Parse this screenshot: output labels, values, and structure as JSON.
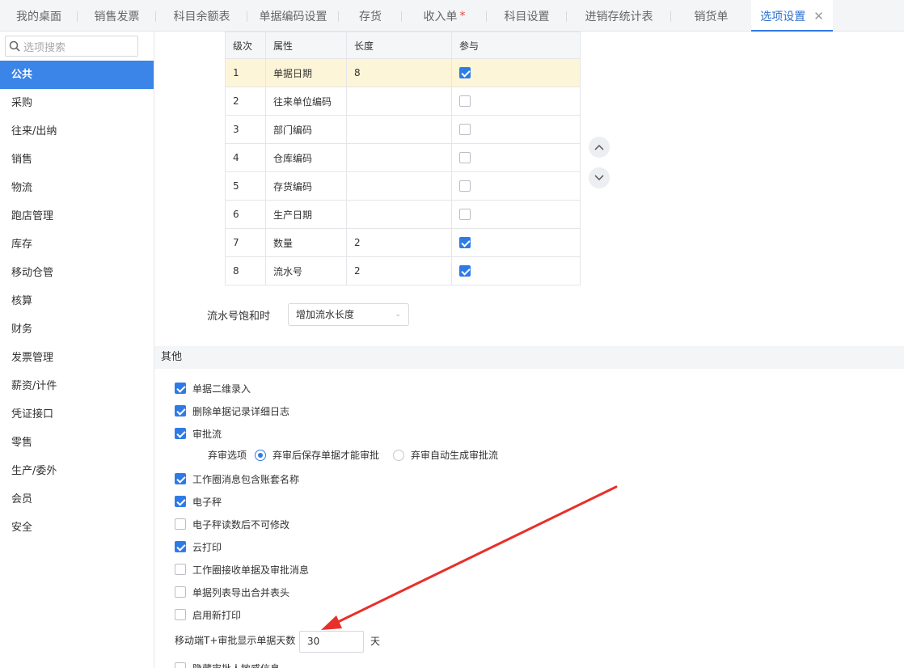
{
  "tabs": [
    {
      "label": "我的桌面"
    },
    {
      "label": "销售发票"
    },
    {
      "label": "科目余额表"
    },
    {
      "label": "单据编码设置"
    },
    {
      "label": "存货"
    },
    {
      "label": "收入单",
      "star": "*"
    },
    {
      "label": "科目设置"
    },
    {
      "label": "进销存统计表"
    },
    {
      "label": "销货单"
    },
    {
      "label": "选项设置",
      "close": "✕"
    }
  ],
  "sidebar": {
    "search_placeholder": "选项搜索",
    "items": [
      {
        "label": "公共"
      },
      {
        "label": "采购"
      },
      {
        "label": "往来/出纳"
      },
      {
        "label": "销售"
      },
      {
        "label": "物流"
      },
      {
        "label": "跑店管理"
      },
      {
        "label": "库存"
      },
      {
        "label": "移动仓管"
      },
      {
        "label": "核算"
      },
      {
        "label": "财务"
      },
      {
        "label": "发票管理"
      },
      {
        "label": "薪资/计件"
      },
      {
        "label": "凭证接口"
      },
      {
        "label": "零售"
      },
      {
        "label": "生产/委外"
      },
      {
        "label": "会员"
      },
      {
        "label": "安全"
      }
    ]
  },
  "code_table": {
    "headers": [
      "级次",
      "属性",
      "长度",
      "参与"
    ],
    "rows": [
      {
        "level": "1",
        "attr": "单据日期",
        "length": "8",
        "checked": true
      },
      {
        "level": "2",
        "attr": "往来单位编码",
        "length": "",
        "checked": false
      },
      {
        "level": "3",
        "attr": "部门编码",
        "length": "",
        "checked": false
      },
      {
        "level": "4",
        "attr": "仓库编码",
        "length": "",
        "checked": false
      },
      {
        "level": "5",
        "attr": "存货编码",
        "length": "",
        "checked": false
      },
      {
        "level": "6",
        "attr": "生产日期",
        "length": "",
        "checked": false
      },
      {
        "level": "7",
        "attr": "数量",
        "length": "2",
        "checked": true
      },
      {
        "level": "8",
        "attr": "流水号",
        "length": "2",
        "checked": true
      }
    ]
  },
  "saturation": {
    "label": "流水号饱和时",
    "value": "增加流水长度"
  },
  "other": {
    "title": "其他",
    "options": [
      {
        "label": "单据二维录入",
        "checked": true
      },
      {
        "label": "删除单据记录详细日志",
        "checked": true
      },
      {
        "label": "审批流",
        "checked": true
      },
      {
        "label": "工作圈消息包含账套名称",
        "checked": true
      },
      {
        "label": "电子秤",
        "checked": true
      },
      {
        "label": "电子秤读数后不可修改",
        "checked": false
      },
      {
        "label": "云打印",
        "checked": true
      },
      {
        "label": "工作圈接收单据及审批消息",
        "checked": false
      },
      {
        "label": "单据列表导出合并表头",
        "checked": false
      },
      {
        "label": "启用新打印",
        "checked": false
      },
      {
        "label": "隐藏审批人敏感信息",
        "checked": false
      }
    ],
    "abandon": {
      "label": "弃审选项",
      "option1": "弃审后保存单据才能审批",
      "option2": "弃审自动生成审批流"
    },
    "days": {
      "label": "移动端T+审批显示单据天数",
      "value": "30",
      "unit": "天"
    }
  },
  "colors": {
    "accent": "#3b84e8",
    "annotation_arrow": "#e8302a"
  }
}
